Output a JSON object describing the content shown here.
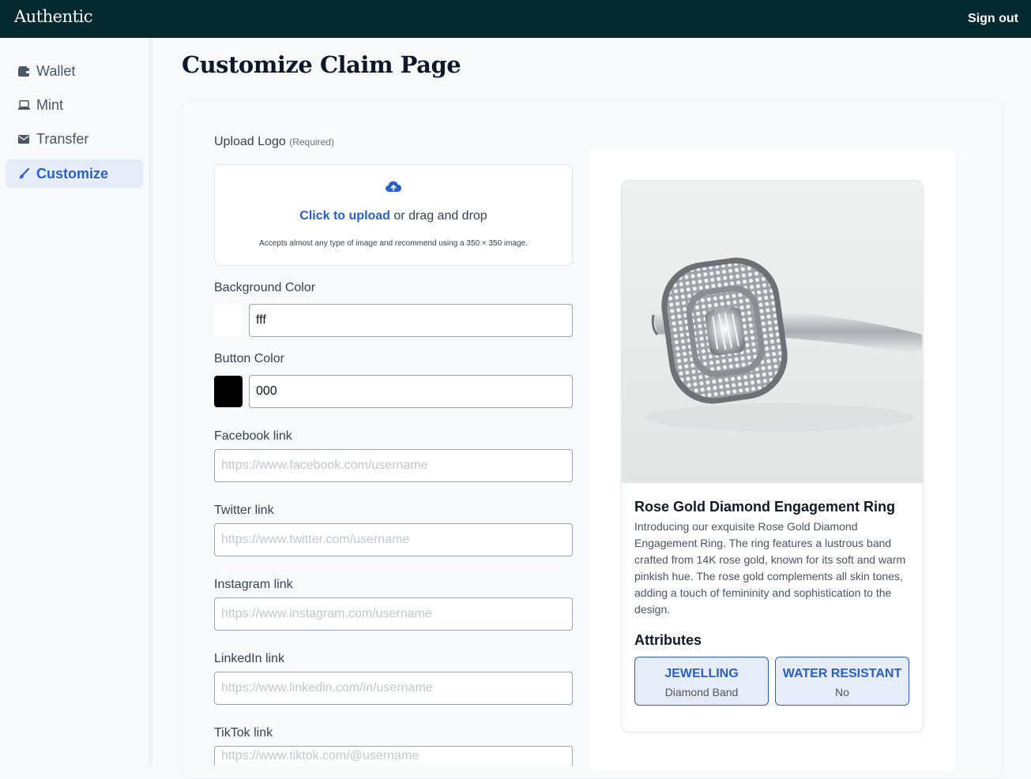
{
  "app": {
    "brand": "Authentic",
    "sign_out": "Sign out"
  },
  "sidebar": {
    "items": [
      {
        "label": "Wallet",
        "icon": "wallet-icon"
      },
      {
        "label": "Mint",
        "icon": "laptop-icon"
      },
      {
        "label": "Transfer",
        "icon": "envelope-icon"
      },
      {
        "label": "Customize",
        "icon": "brush-icon",
        "active": true
      }
    ]
  },
  "page": {
    "title": "Customize Claim Page"
  },
  "form": {
    "logo": {
      "label": "Upload Logo",
      "required": "(Required)",
      "click_text": "Click to upload",
      "drag_text": " or drag and drop",
      "note": "Accepts almost any type of image and recommend using a 350 × 350 image."
    },
    "background_color": {
      "label": "Background Color",
      "value": "fff",
      "swatch": "#ffffff"
    },
    "button_color": {
      "label": "Button Color",
      "value": "000",
      "swatch": "#000000"
    },
    "facebook": {
      "label": "Facebook link",
      "placeholder": "https://www.facebook.com/username"
    },
    "twitter": {
      "label": "Twitter link",
      "placeholder": "https://www.twitter.com/username"
    },
    "instagram": {
      "label": "Instagram link",
      "placeholder": "https://www.instagram.com/username"
    },
    "linkedin": {
      "label": "LinkedIn link",
      "placeholder": "https://www.linkedin.com/in/username"
    },
    "tiktok": {
      "label": "TikTok link",
      "placeholder": "https://www.tiktok.com/@username"
    }
  },
  "preview": {
    "title": "Rose Gold Diamond Engagement Ring",
    "description": "Introducing our exquisite Rose Gold Diamond Engagement Ring. The ring features a lustrous band crafted from 14K rose gold, known for its soft and warm pinkish hue. The rose gold complements all skin tones, adding a touch of femininity and sophistication to the design.",
    "attributes_heading": "Attributes",
    "attributes": [
      {
        "key": "JEWELLING",
        "value": "Diamond Band"
      },
      {
        "key": "WATER RESISTANT",
        "value": "No"
      }
    ]
  },
  "colors": {
    "topbar": "#04292f",
    "accent": "#2a5fc9",
    "accent_bg": "#e6edf8"
  }
}
